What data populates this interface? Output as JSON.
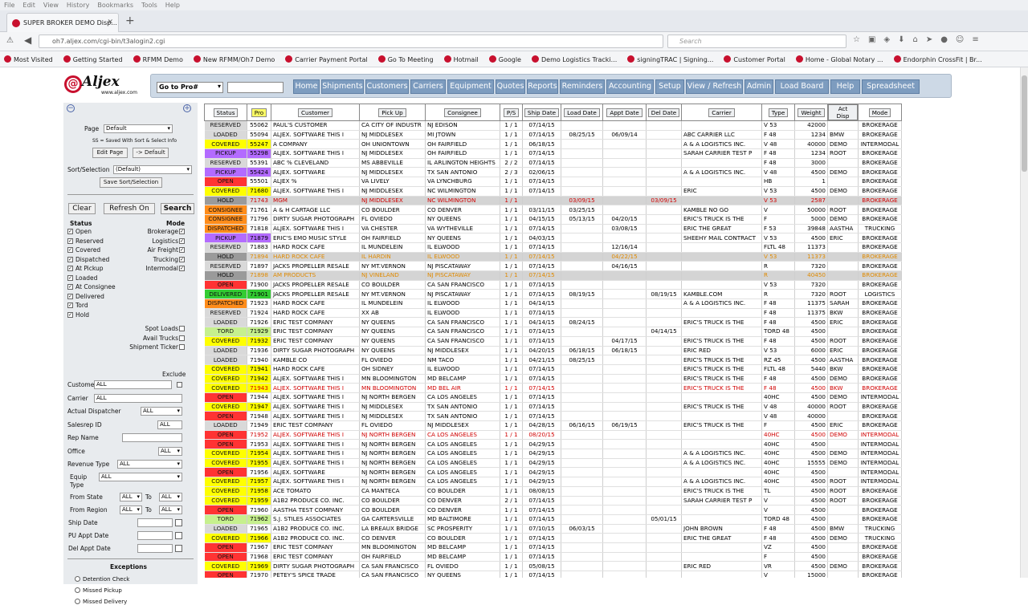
{
  "browser": {
    "menus": [
      "File",
      "Edit",
      "View",
      "History",
      "Bookmarks",
      "Tools",
      "Help"
    ],
    "tab_title": "SUPER BROKER DEMO Disp...",
    "url": "oh7.aljex.com/cgi-bin/t3alogin2.cgi",
    "search_placeholder": "Search",
    "bookmarks": [
      "Most Visited",
      "Getting Started",
      "RFMM Demo",
      "New RFMM/Oh7 Demo",
      "Carrier Payment Portal",
      "Go To Meeting",
      "Hotmail",
      "Google",
      "Demo Logistics Tracki...",
      "signingTRAC | Signing...",
      "Customer Portal",
      "Home - Global Notary ...",
      "Endorphin CrossFit | Br..."
    ]
  },
  "logo": {
    "brand": "Aljex",
    "site": "www.aljex.com"
  },
  "topnav": {
    "goto": "Go to Pro#",
    "buttons": [
      "Home",
      "Shipments",
      "Customers",
      "Carriers",
      "Equipment",
      "Quotes",
      "Reports",
      "Reminders",
      "Accounting",
      "Setup",
      "View / Refresh",
      "Admin",
      "Load Board",
      "Help",
      "Spreadsheet"
    ]
  },
  "sidebar": {
    "page_label": "Page",
    "page_value": "Default",
    "saved_note": "SS = Saved With Sort & Select Info",
    "edit_page": "Edit Page",
    "to_default": "-> Default",
    "sort_label": "Sort/Selection",
    "sort_value": "(Default)",
    "save_sort": "Save Sort/Selection",
    "clear": "Clear",
    "refresh": "Refresh On",
    "search": "Search",
    "status_head": "Status",
    "mode_head": "Mode",
    "statuses": [
      "Open",
      "Reserved",
      "Covered",
      "Dispatched",
      "At Pickup",
      "Loaded",
      "At Consignee",
      "Delivered",
      "Tord",
      "Hold"
    ],
    "modes": [
      "Brokerage",
      "Logistics",
      "Air Freight",
      "Trucking",
      "Intermodal"
    ],
    "extras": [
      "Spot Loads",
      "Avail Trucks",
      "Shipment Ticker"
    ],
    "exclude": "Exclude",
    "customer_label": "Customer",
    "customer_value": "ALL",
    "carrier_label": "Carrier",
    "carrier_value": "ALL",
    "dispatcher_label": "Actual Dispatcher",
    "dispatcher_value": "ALL",
    "salesrep_label": "Salesrep ID",
    "salesrep_value": "ALL",
    "repname_label": "Rep Name",
    "office_label": "Office",
    "office_value": "ALL",
    "revenue_label": "Revenue Type",
    "revenue_value": "ALL",
    "equip_label": "Equip Type",
    "equip_value": "ALL",
    "fromstate_label": "From State",
    "fromstate_value": "ALL",
    "to_label": "To",
    "tostate_value": "ALL",
    "fromregion_label": "From Region",
    "fromregion_value": "ALL",
    "toregion_value": "ALL",
    "shipdate_label": "Ship Date",
    "puappt_label": "PU Appt Date",
    "delappt_label": "Del Appt Date",
    "exceptions_head": "Exceptions",
    "exceptions": [
      "Detention Check",
      "Missed Pickup",
      "Missed Delivery"
    ]
  },
  "colors": {
    "RESERVED": "#d9d9d9",
    "LOADED": "#d9d9d9",
    "COVERED": "#ffff00",
    "PICKUP": "#b36bff",
    "OPEN": "#ff3333",
    "HOLD": "#9a9a9a",
    "CONSIGNEE": "#ff8c1a",
    "DISPATCHED": "#ff8c1a",
    "TORD": "#c6f08e",
    "DELIVERED": "#33cc33"
  },
  "table": {
    "headers": [
      "Status",
      "Pro",
      "Customer",
      "Pick Up",
      "Consignee",
      "P/S",
      "Ship Date",
      "Load Date",
      "Appt Date",
      "Del Date",
      "Carrier",
      "Type",
      "Weight",
      "Act Disp",
      "Mode"
    ],
    "rows": [
      [
        "RESERVED",
        "55062",
        "PAUL'S CUSTOMER",
        "CA CITY OF INDUSTR",
        "NJ EDISON",
        "1 / 1",
        "07/14/15",
        "",
        "",
        "",
        "",
        "V 53",
        "42000",
        "",
        "BROKERAGE",
        ""
      ],
      [
        "LOADED",
        "55094",
        "ALJEX. SOFTWARE THIS I",
        "NJ MIDDLESEX",
        "MI JTOWN",
        "1 / 1",
        "07/14/15",
        "08/25/15",
        "06/09/14",
        "",
        "ABC CARRIER LLC",
        "F 48",
        "1234",
        "BMW",
        "BROKERAGE",
        ""
      ],
      [
        "COVERED",
        "55247",
        "A COMPANY",
        "OH UNIONTOWN",
        "OH FAIRFIELD",
        "1 / 1",
        "06/18/15",
        "",
        "",
        "",
        "A & A LOGISTICS INC.",
        "V 48",
        "40000",
        "DEMO",
        "INTERMODAL",
        ""
      ],
      [
        "PICKUP",
        "55298",
        "ALJEX. SOFTWARE THIS I",
        "NJ MIDDLESEX",
        "OH FAIRFIELD",
        "1 / 1",
        "07/14/15",
        "",
        "",
        "",
        "SARAH CARRIER TEST P",
        "F 48",
        "1234",
        "ROOT",
        "BROKERAGE",
        ""
      ],
      [
        "RESERVED",
        "55391",
        "ABC % CLEVELAND",
        "MS ABBEVILLE",
        "IL ARLINGTON HEIGHTS",
        "2 / 2",
        "07/14/15",
        "",
        "",
        "",
        "",
        "F 48",
        "3000",
        "",
        "BROKERAGE",
        ""
      ],
      [
        "PICKUP",
        "55424",
        "ALJEX. SOFTWARE",
        "NJ MIDDLESEX",
        "TX SAN ANTONIO",
        "2 / 3",
        "02/06/15",
        "",
        "",
        "",
        "A & A LOGISTICS INC.",
        "V 48",
        "4500",
        "DEMO",
        "BROKERAGE",
        ""
      ],
      [
        "OPEN",
        "55501",
        "ALJEX %",
        "VA LIVELY",
        "VA LYNCHBURG",
        "1 / 1",
        "07/14/15",
        "",
        "",
        "",
        "",
        "HB",
        "1",
        "",
        "BROKERAGE",
        ""
      ],
      [
        "COVERED",
        "71680",
        "ALJEX. SOFTWARE THIS I",
        "NJ MIDDLESEX",
        "NC WILMINGTON",
        "1 / 1",
        "07/14/15",
        "",
        "",
        "",
        "ERIC",
        "V 53",
        "4500",
        "DEMO",
        "BROKERAGE",
        ""
      ],
      [
        "HOLD",
        "71743",
        "MGM",
        "NJ MIDDLESEX",
        "NC WILMINGTON",
        "1 / 1",
        "",
        "03/09/15",
        "",
        "03/09/15",
        "",
        "V 53",
        "2587",
        "",
        "BROKERAGE",
        "grey red"
      ],
      [
        "CONSIGNEE",
        "71761",
        "A & H CARTAGE LLC",
        "CO BOULDER",
        "CO DENVER",
        "1 / 1",
        "03/11/15",
        "03/25/15",
        "",
        "",
        "KAMBLE NO GO",
        "V",
        "50000",
        "ROOT",
        "BROKERAGE",
        ""
      ],
      [
        "CONSIGNEE",
        "71796",
        "DIRTY SUGAR PHOTOGRAPH",
        "FL OVIEDO",
        "NY QUEENS",
        "1 / 1",
        "04/15/15",
        "05/13/15",
        "04/20/15",
        "",
        "ERIC'S TRUCK IS THE",
        "F",
        "5000",
        "DEMO",
        "BROKERAGE",
        ""
      ],
      [
        "DISPATCHED",
        "71818",
        "ALJEX. SOFTWARE THIS I",
        "VA CHESTER",
        "VA WYTHEVILLE",
        "1 / 1",
        "07/14/15",
        "",
        "03/08/15",
        "",
        "ERIC THE GREAT",
        "F 53",
        "39848",
        "AASTHA",
        "TRUCKING",
        ""
      ],
      [
        "PICKUP",
        "71879",
        "ERIC'S EMO MUSIC STYLE",
        "OH FAIRFIELD",
        "NY QUEENS",
        "1 / 1",
        "04/03/15",
        "",
        "",
        "",
        "SHEEHY MAIL CONTRACT",
        "V 53",
        "4500",
        "ERIC",
        "BROKERAGE",
        ""
      ],
      [
        "RESERVED",
        "71883",
        "HARD ROCK CAFE",
        "IL MUNDELEIN",
        "IL ELWOOD",
        "1 / 1",
        "07/14/15",
        "",
        "12/16/14",
        "",
        "",
        "FLTL 48",
        "11373",
        "",
        "BROKERAGE",
        ""
      ],
      [
        "HOLD",
        "71894",
        "HARD ROCK CAFE",
        "IL HARDIN",
        "IL ELWOOD",
        "1 / 1",
        "07/14/15",
        "",
        "04/22/15",
        "",
        "",
        "V 53",
        "11373",
        "",
        "BROKERAGE",
        "grey orange"
      ],
      [
        "RESERVED",
        "71897",
        "JACKS PROPELLER RESALE",
        "NY MT.VERNON",
        "NJ PISCATAWAY",
        "1 / 1",
        "07/14/15",
        "",
        "04/16/15",
        "",
        "",
        "R",
        "7320",
        "",
        "BROKERAGE",
        ""
      ],
      [
        "HOLD",
        "71898",
        "AM PRODUCTS",
        "NJ VINELAND",
        "NJ PISCATAWAY",
        "1 / 1",
        "07/14/15",
        "",
        "",
        "",
        "",
        "R",
        "40450",
        "",
        "BROKERAGE",
        "grey orange"
      ],
      [
        "OPEN",
        "71900",
        "JACKS PROPELLER RESALE",
        "CO BOULDER",
        "CA SAN FRANCISCO",
        "1 / 1",
        "07/14/15",
        "",
        "",
        "",
        "",
        "V 53",
        "7320",
        "",
        "BROKERAGE",
        ""
      ],
      [
        "DELIVERED",
        "71901",
        "JACKS PROPELLER RESALE",
        "NY MT.VERNON",
        "NJ PISCATAWAY",
        "1 / 1",
        "07/14/15",
        "08/19/15",
        "",
        "08/19/15",
        "KAMBLE.COM",
        "R",
        "7320",
        "ROOT",
        "LOGISTICS",
        ""
      ],
      [
        "DISPATCHED",
        "71923",
        "HARD ROCK CAFE",
        "IL MUNDELEIN",
        "IL ELWOOD",
        "1 / 1",
        "04/14/15",
        "",
        "",
        "",
        "A & A LOGISTICS INC.",
        "F 48",
        "11375",
        "SARAH",
        "BROKERAGE",
        ""
      ],
      [
        "RESERVED",
        "71924",
        "HARD ROCK CAFE",
        "XX AB",
        "IL ELWOOD",
        "1 / 1",
        "07/14/15",
        "",
        "",
        "",
        "",
        "F 48",
        "11375",
        "BKW",
        "BROKERAGE",
        ""
      ],
      [
        "LOADED",
        "71926",
        "ERIC TEST COMPANY",
        "NY QUEENS",
        "CA SAN FRANCISCO",
        "1 / 1",
        "04/14/15",
        "08/24/15",
        "",
        "",
        "ERIC'S TRUCK IS THE",
        "F 48",
        "4500",
        "ERIC",
        "BROKERAGE",
        ""
      ],
      [
        "TORD",
        "71929",
        "ERIC TEST COMPANY",
        "NY QUEENS",
        "CA SAN FRANCISCO",
        "1 / 1",
        "07/14/15",
        "",
        "",
        "04/14/15",
        "",
        "TORD 48",
        "4500",
        "",
        "BROKERAGE",
        ""
      ],
      [
        "COVERED",
        "71932",
        "ERIC TEST COMPANY",
        "NY QUEENS",
        "CA SAN FRANCISCO",
        "1 / 1",
        "07/14/15",
        "",
        "04/17/15",
        "",
        "ERIC'S TRUCK IS THE",
        "F 48",
        "4500",
        "ROOT",
        "BROKERAGE",
        ""
      ],
      [
        "LOADED",
        "71936",
        "DIRTY SUGAR PHOTOGRAPH",
        "NY QUEENS",
        "NJ MIDDLESEX",
        "1 / 1",
        "04/20/15",
        "06/18/15",
        "06/18/15",
        "",
        "ERIC RED",
        "V 53",
        "6000",
        "ERIC",
        "BROKERAGE",
        ""
      ],
      [
        "LOADED",
        "71940",
        "KAMBLE CO",
        "FL OVIEDO",
        "NM TACO",
        "1 / 1",
        "04/21/15",
        "08/25/15",
        "",
        "",
        "ERIC'S TRUCK IS THE",
        "RZ 45",
        "4500",
        "AASTHA",
        "BROKERAGE",
        ""
      ],
      [
        "COVERED",
        "71941",
        "HARD ROCK CAFE",
        "OH SIDNEY",
        "IL ELWOOD",
        "1 / 1",
        "07/14/15",
        "",
        "",
        "",
        "ERIC'S TRUCK IS THE",
        "FLTL 48",
        "5440",
        "BKW",
        "BROKERAGE",
        ""
      ],
      [
        "COVERED",
        "71942",
        "ALJEX. SOFTWARE THIS I",
        "MN BLOOMINGTON",
        "MD BELCAMP",
        "1 / 1",
        "07/14/15",
        "",
        "",
        "",
        "ERIC'S TRUCK IS THE",
        "F 48",
        "4500",
        "DEMO",
        "BROKERAGE",
        ""
      ],
      [
        "COVERED",
        "71943",
        "ALJEX. SOFTWARE THIS I",
        "MN BLOOMINGTON",
        "MD BEL AIR",
        "1 / 1",
        "07/14/15",
        "",
        "",
        "",
        "ERIC'S TRUCK IS THE",
        "F 48",
        "4500",
        "BKW",
        "BROKERAGE",
        "red"
      ],
      [
        "OPEN",
        "71944",
        "ALJEX. SOFTWARE THIS I",
        "NJ NORTH BERGEN",
        "CA LOS ANGELES",
        "1 / 1",
        "07/14/15",
        "",
        "",
        "",
        "",
        "40HC",
        "4500",
        "DEMO",
        "INTERMODAL",
        ""
      ],
      [
        "COVERED",
        "71947",
        "ALJEX. SOFTWARE THIS I",
        "NJ MIDDLESEX",
        "TX SAN ANTONIO",
        "1 / 1",
        "07/14/15",
        "",
        "",
        "",
        "ERIC'S TRUCK IS THE",
        "V 48",
        "40000",
        "ROOT",
        "BROKERAGE",
        ""
      ],
      [
        "OPEN",
        "71948",
        "ALJEX. SOFTWARE THIS I",
        "NJ MIDDLESEX",
        "TX SAN ANTONIO",
        "1 / 1",
        "07/14/15",
        "",
        "",
        "",
        "",
        "V 48",
        "40000",
        "",
        "BROKERAGE",
        ""
      ],
      [
        "LOADED",
        "71949",
        "ERIC TEST COMPANY",
        "FL OVIEDO",
        "NJ MIDDLESEX",
        "1 / 1",
        "04/28/15",
        "06/16/15",
        "06/19/15",
        "",
        "ERIC'S TRUCK IS THE",
        "F",
        "4500",
        "ERIC",
        "BROKERAGE",
        ""
      ],
      [
        "OPEN",
        "71952",
        "ALJEX. SOFTWARE THIS I",
        "NJ NORTH BERGEN",
        "CA LOS ANGELES",
        "1 / 1",
        "08/20/15",
        "",
        "",
        "",
        "",
        "40HC",
        "4500",
        "DEMO",
        "INTERMODAL",
        "red"
      ],
      [
        "OPEN",
        "71953",
        "ALJEX. SOFTWARE THIS I",
        "NJ NORTH BERGEN",
        "CA LOS ANGELES",
        "1 / 1",
        "04/29/15",
        "",
        "",
        "",
        "",
        "40HC",
        "4500",
        "",
        "INTERMODAL",
        ""
      ],
      [
        "COVERED",
        "71954",
        "ALJEX. SOFTWARE THIS I",
        "NJ NORTH BERGEN",
        "CA LOS ANGELES",
        "1 / 1",
        "04/29/15",
        "",
        "",
        "",
        "A & A LOGISTICS INC.",
        "40HC",
        "4500",
        "DEMO",
        "INTERMODAL",
        ""
      ],
      [
        "COVERED",
        "71955",
        "ALJEX. SOFTWARE THIS I",
        "NJ NORTH BERGEN",
        "CA LOS ANGELES",
        "1 / 1",
        "04/29/15",
        "",
        "",
        "",
        "A & A LOGISTICS INC.",
        "40HC",
        "15555",
        "DEMO",
        "INTERMODAL",
        ""
      ],
      [
        "OPEN",
        "71956",
        "ALJEX. SOFTWARE",
        "NJ NORTH BERGEN",
        "CA LOS ANGELES",
        "1 / 1",
        "04/29/15",
        "",
        "",
        "",
        "",
        "40HC",
        "4500",
        "",
        "INTERMODAL",
        ""
      ],
      [
        "COVERED",
        "71957",
        "ALJEX. SOFTWARE THIS I",
        "NJ NORTH BERGEN",
        "CA LOS ANGELES",
        "1 / 1",
        "04/29/15",
        "",
        "",
        "",
        "A & A LOGISTICS INC.",
        "40HC",
        "4500",
        "ROOT",
        "INTERMODAL",
        ""
      ],
      [
        "COVERED",
        "71958",
        "ACE TOMATO",
        "CA MANTECA",
        "CO BOULDER",
        "1 / 1",
        "08/08/15",
        "",
        "",
        "",
        "ERIC'S TRUCK IS THE",
        "TL",
        "4500",
        "ROOT",
        "BROKERAGE",
        ""
      ],
      [
        "COVERED",
        "71959",
        "A1B2 PRODUCE CO. INC.",
        "CO BOULDER",
        "CO DENVER",
        "2 / 1",
        "07/14/15",
        "",
        "",
        "",
        "SARAH CARRIER TEST P",
        "V",
        "4500",
        "ROOT",
        "BROKERAGE",
        ""
      ],
      [
        "OPEN",
        "71960",
        "AASTHA TEST COMPANY",
        "CO BOULDER",
        "CO DENVER",
        "1 / 1",
        "07/14/15",
        "",
        "",
        "",
        "",
        "V",
        "4500",
        "",
        "BROKERAGE",
        ""
      ],
      [
        "TORD",
        "71962",
        "S.J. STILES ASSOCIATES",
        "GA CARTERSVILLE",
        "MD BALTIMORE",
        "1 / 1",
        "07/14/15",
        "",
        "",
        "05/01/15",
        "",
        "TORD 48",
        "4500",
        "",
        "BROKERAGE",
        ""
      ],
      [
        "LOADED",
        "71965",
        "A1B2 PRODUCE CO. INC.",
        "LA BREAUX BRIDGE",
        "SC PROSPERITY",
        "1 / 1",
        "07/10/15",
        "06/03/15",
        "",
        "",
        "JOHN BROWN",
        "F 48",
        "4500",
        "BMW",
        "TRUCKING",
        ""
      ],
      [
        "COVERED",
        "71966",
        "A1B2 PRODUCE CO. INC.",
        "CO DENVER",
        "CO BOULDER",
        "1 / 1",
        "07/14/15",
        "",
        "",
        "",
        "ERIC THE GREAT",
        "F 48",
        "4500",
        "DEMO",
        "TRUCKING",
        ""
      ],
      [
        "OPEN",
        "71967",
        "ERIC TEST COMPANY",
        "MN BLOOMINGTON",
        "MD BELCAMP",
        "1 / 1",
        "07/14/15",
        "",
        "",
        "",
        "",
        "VZ",
        "4500",
        "",
        "BROKERAGE",
        ""
      ],
      [
        "OPEN",
        "71968",
        "ERIC TEST COMPANY",
        "OH FAIRFIELD",
        "MD BELCAMP",
        "1 / 1",
        "07/14/15",
        "",
        "",
        "",
        "",
        "F",
        "4500",
        "",
        "BROKERAGE",
        ""
      ],
      [
        "COVERED",
        "71969",
        "DIRTY SUGAR PHOTOGRAPH",
        "CA SAN FRANCISCO",
        "FL OVIEDO",
        "1 / 1",
        "05/08/15",
        "",
        "",
        "",
        "ERIC RED",
        "VR",
        "4500",
        "DEMO",
        "BROKERAGE",
        ""
      ],
      [
        "OPEN",
        "71970",
        "PETEY'S SPICE TRADE",
        "CA SAN FRANCISCO",
        "NY QUEENS",
        "1 / 1",
        "07/14/15",
        "",
        "",
        "",
        "",
        "V",
        "15000",
        "",
        "BROKERAGE",
        ""
      ]
    ]
  }
}
